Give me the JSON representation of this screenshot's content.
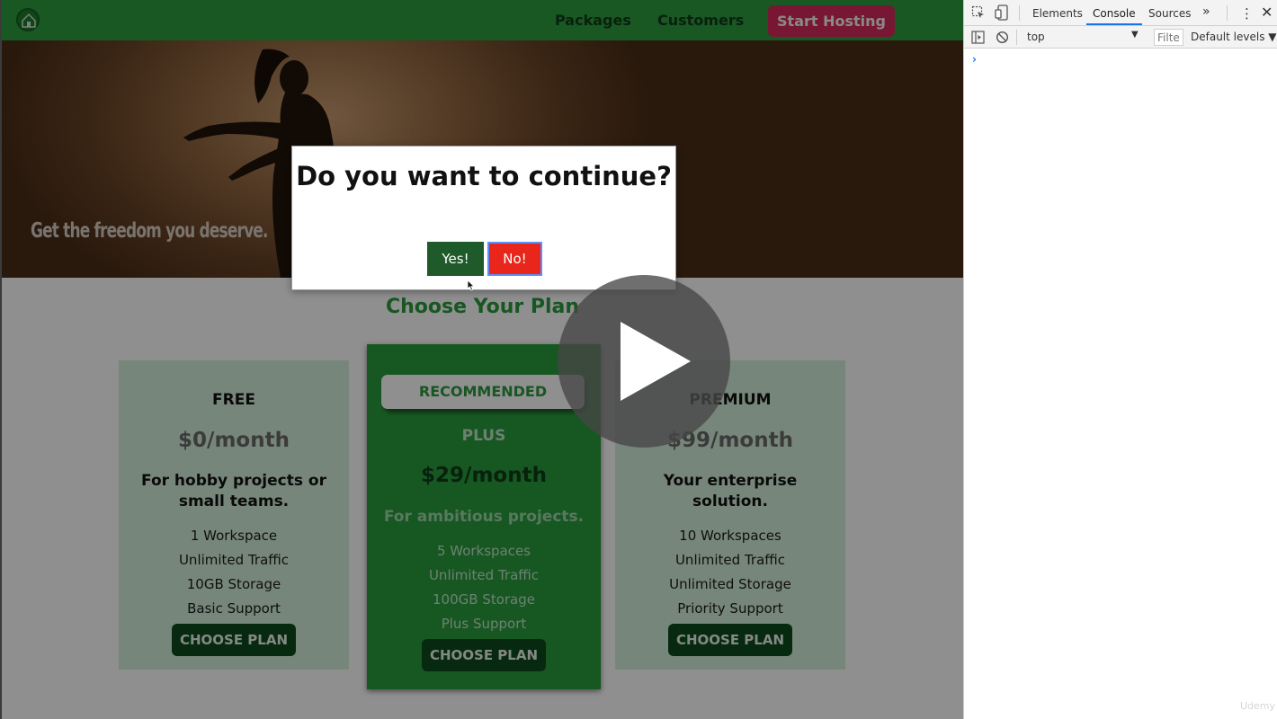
{
  "nav": {
    "packages": "Packages",
    "customers": "Customers",
    "cta": "Start Hosting",
    "logo_icon": "hosting-logo-icon"
  },
  "hero": {
    "tagline": "Get the freedom you deserve."
  },
  "plans": {
    "title": "Choose Your Plan",
    "cards": [
      {
        "name": "FREE",
        "price": "$0/month",
        "description": "For hobby projects or small teams.",
        "features": [
          "1 Workspace",
          "Unlimited Traffic",
          "10GB Storage",
          "Basic Support"
        ],
        "button": "CHOOSE PLAN"
      },
      {
        "badge": "RECOMMENDED",
        "name": "PLUS",
        "price": "$29/month",
        "description": "For ambitious projects.",
        "features": [
          "5 Workspaces",
          "Unlimited Traffic",
          "100GB Storage",
          "Plus Support"
        ],
        "button": "CHOOSE PLAN"
      },
      {
        "name": "PREMIUM",
        "price": "$99/month",
        "description": "Your enterprise solution.",
        "features": [
          "10 Workspaces",
          "Unlimited Traffic",
          "Unlimited Storage",
          "Priority Support"
        ],
        "button": "CHOOSE PLAN"
      }
    ]
  },
  "dialog": {
    "question": "Do you want to continue?",
    "yes": "Yes!",
    "no": "No!"
  },
  "devtools": {
    "tabs": [
      "Elements",
      "Console",
      "Sources"
    ],
    "active_tab": "Console",
    "more": "»",
    "context": "top",
    "filter_placeholder": "Filter",
    "levels": "Default levels ▼",
    "prompt": "›"
  },
  "watermark": "Udemy",
  "colors": {
    "brand_green": "#2d9b3f",
    "dark_green": "#0d4a1c",
    "cta_pink": "#d62a5c",
    "no_red": "#e8261b",
    "devtools_active": "#1a73e8"
  }
}
